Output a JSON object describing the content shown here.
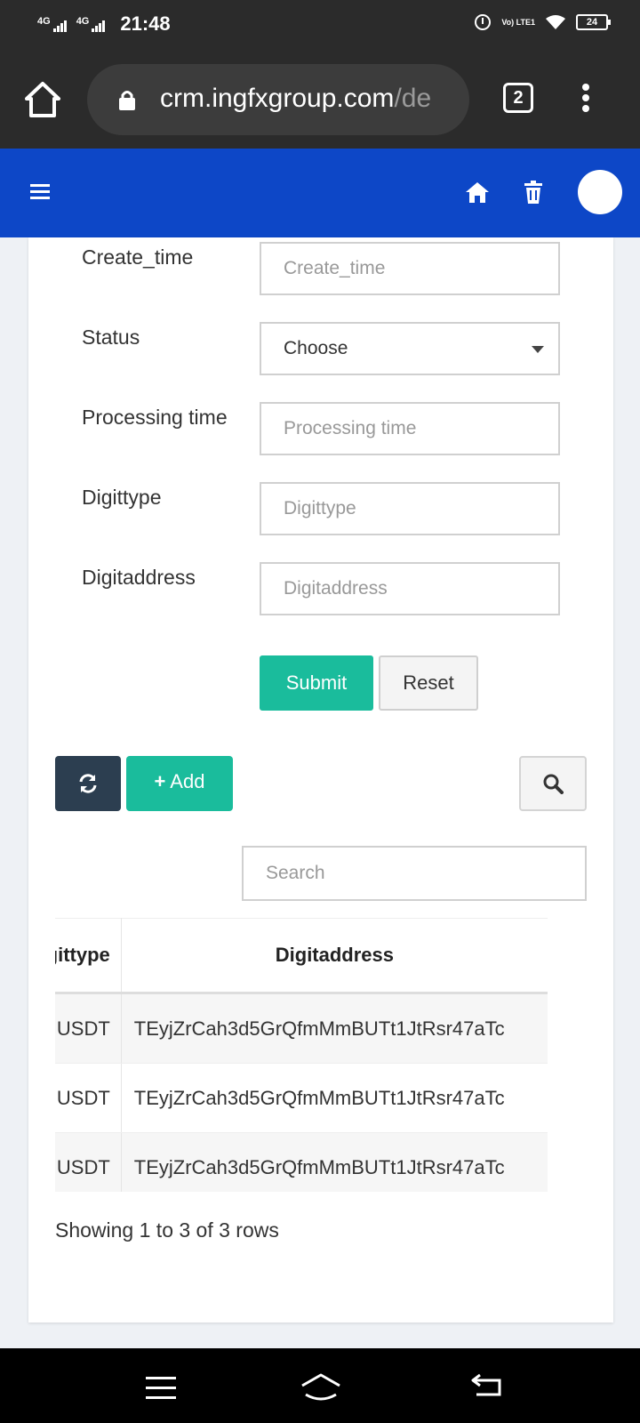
{
  "status_bar": {
    "network_1": "4G",
    "network_2": "4G",
    "time": "21:48",
    "volte": "Vo) LTE1",
    "battery": "24"
  },
  "browser": {
    "url_domain": "crm.ingfxgroup.com",
    "url_path": "/de",
    "tab_count": "2"
  },
  "form": {
    "fields": [
      {
        "label": "Create_time",
        "placeholder": "Create_time"
      },
      {
        "label": "Status",
        "value": "Choose"
      },
      {
        "label": "Processing time",
        "placeholder": "Processing time"
      },
      {
        "label": "Digittype",
        "placeholder": "Digittype"
      },
      {
        "label": "Digitaddress",
        "placeholder": "Digitaddress"
      }
    ],
    "submit_label": "Submit",
    "reset_label": "Reset"
  },
  "toolbar": {
    "add_label": "Add",
    "search_placeholder": "Search"
  },
  "table": {
    "headers": [
      "Digittype",
      "Digitaddress"
    ],
    "rows": [
      [
        "USDT",
        "TEyjZrCah3d5GrQfmMmBUTt1JtRsr47aTc"
      ],
      [
        "USDT",
        "TEyjZrCah3d5GrQfmMmBUTt1JtRsr47aTc"
      ],
      [
        "USDT",
        "TEyjZrCah3d5GrQfmMmBUTt1JtRsr47aTc"
      ]
    ]
  },
  "pagination_info": "Showing 1 to 3 of 3 rows",
  "colors": {
    "header_blue": "#0d47c7",
    "success_green": "#1abc9c",
    "dark_navy": "#2c3e50"
  }
}
